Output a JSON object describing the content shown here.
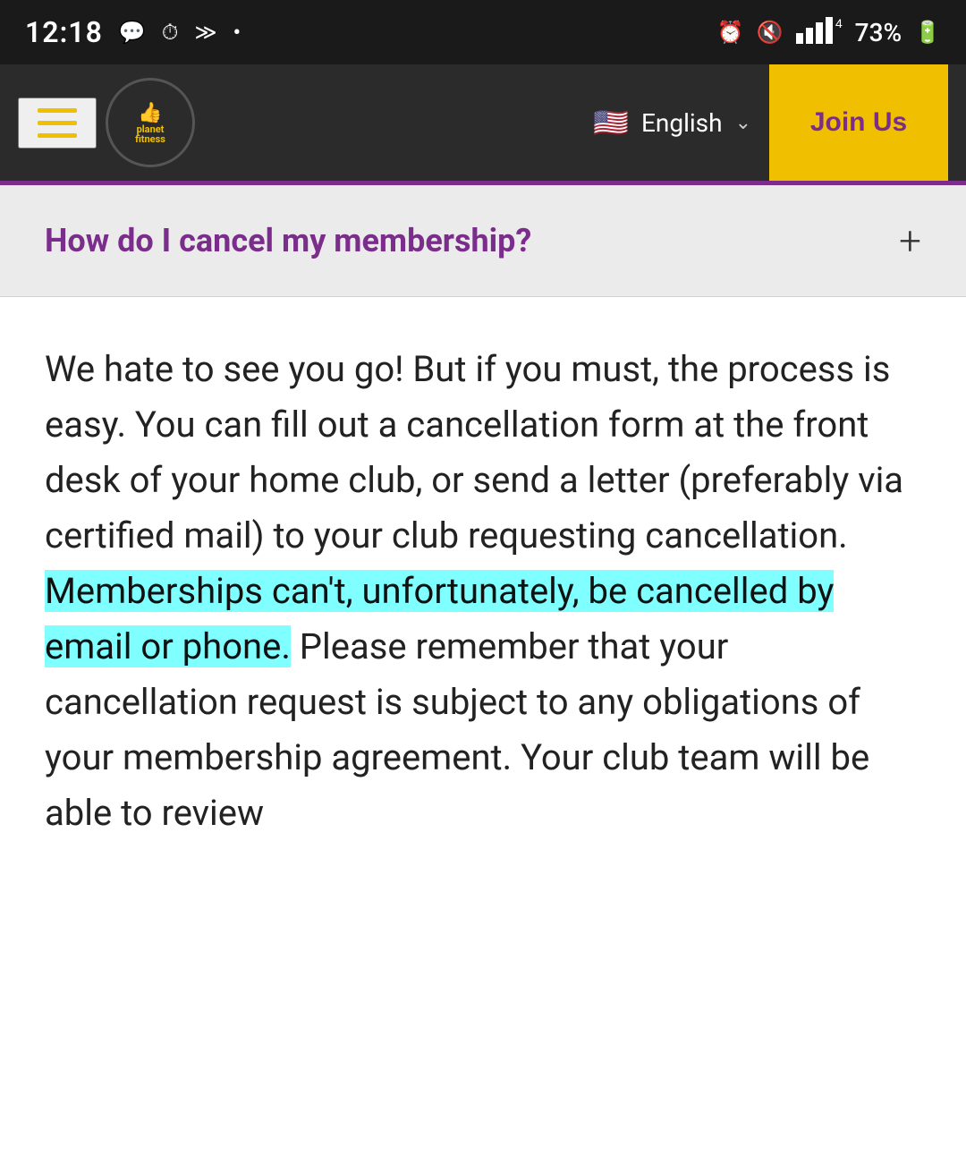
{
  "status_bar": {
    "time": "12:18",
    "icons_left": [
      "chat-icon",
      "clock-icon",
      "forward-icon",
      "dot-icon"
    ],
    "battery_percent": "73%",
    "signal_label": "4GE"
  },
  "nav": {
    "logo_line1": "planet",
    "logo_line2": "fitness",
    "language_label": "English",
    "join_us_label": "Join Us"
  },
  "faq": {
    "question": "How do I cancel my membership?",
    "toggle_icon": "+"
  },
  "content": {
    "paragraph_plain": "We hate to see you go! But if you must, the process is easy. You can fill out a cancellation form at the front desk of your home club, or send a letter (preferably via certified mail) to your club requesting cancellation.",
    "paragraph_highlighted": "Memberships can't, unfortunately, be cancelled by email or phone.",
    "paragraph_after": " Please remember that your cancellation request is subject to any obligations of your membership agreement. Your club team will be able to review"
  },
  "colors": {
    "brand_purple": "#7b2d8b",
    "brand_yellow": "#f0c000",
    "highlight_cyan": "#7fffff",
    "status_bar_bg": "#1a1a1a",
    "nav_bg": "#2b2b2b",
    "faq_bg": "#ebebeb"
  }
}
